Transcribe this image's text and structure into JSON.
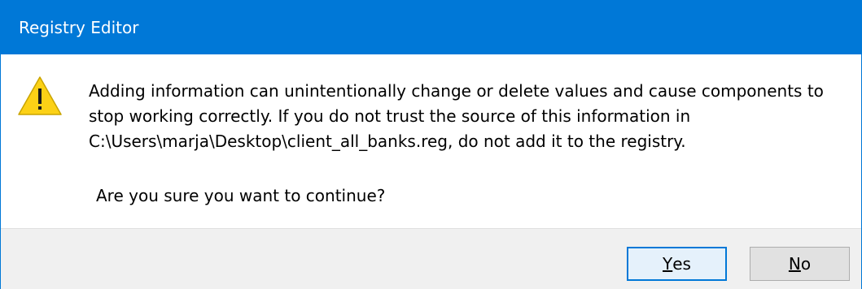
{
  "window": {
    "title": "Registry Editor"
  },
  "dialog": {
    "icon": "warning-icon",
    "message_lines": [
      "Adding information can unintentionally change or delete values and cause components to",
      "stop working correctly. If you do not trust the source of this information in",
      "C:\\Users\\marja\\Desktop\\client_all_banks.reg, do not add it to the registry."
    ],
    "question": "Are you sure you want to continue?"
  },
  "buttons": {
    "yes": {
      "mnemonic": "Y",
      "rest": "es"
    },
    "no": {
      "mnemonic": "N",
      "rest": "o"
    }
  },
  "colors": {
    "titlebar": "#0078d7",
    "footer": "#f0f0f0",
    "warning": "#fcd116"
  }
}
